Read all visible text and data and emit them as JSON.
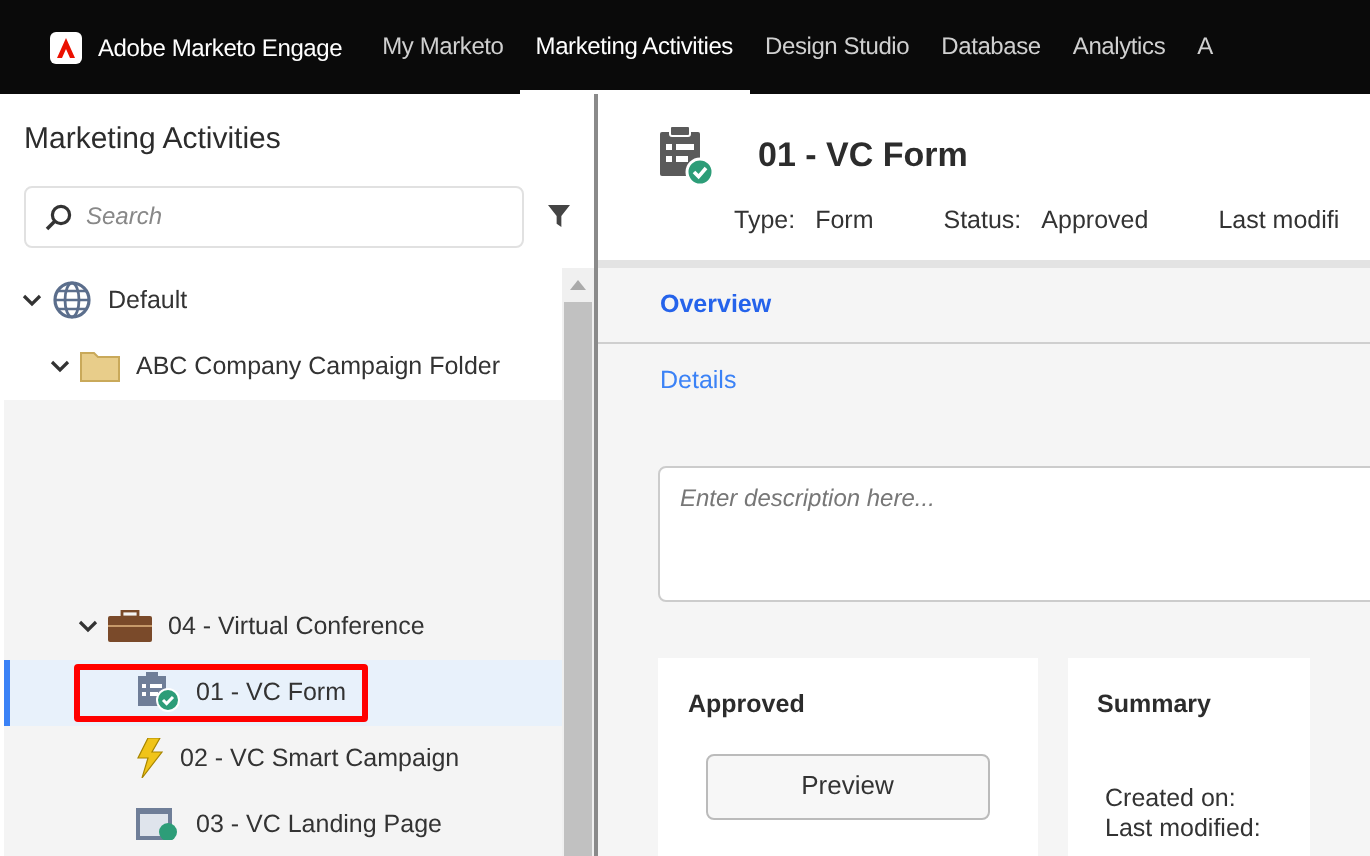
{
  "app": {
    "name": "Adobe Marketo Engage"
  },
  "nav_tabs": [
    {
      "label": "My Marketo",
      "selected": false
    },
    {
      "label": "Marketing Activities",
      "selected": true
    },
    {
      "label": "Design Studio",
      "selected": false
    },
    {
      "label": "Database",
      "selected": false
    },
    {
      "label": "Analytics",
      "selected": false
    },
    {
      "label": "A",
      "selected": false
    }
  ],
  "sidebar": {
    "title": "Marketing Activities",
    "search": {
      "placeholder": "Search"
    },
    "tree": [
      {
        "label": "Default",
        "kind": "workspace",
        "expanded": true,
        "selected": false,
        "children": [
          {
            "label": "ABC Company Campaign Folder",
            "kind": "folder",
            "expanded": true,
            "selected": false,
            "children": [
              {
                "label": "04 - Virtual Conference",
                "kind": "program",
                "expanded": true,
                "selected": false,
                "children": [
                  {
                    "label": "01 - VC Form",
                    "kind": "form",
                    "selected": true,
                    "highlighted": true
                  },
                  {
                    "label": "02 - VC Smart Campaign",
                    "kind": "campaign",
                    "selected": false,
                    "highlighted": false
                  },
                  {
                    "label": "03 - VC Landing Page",
                    "kind": "page",
                    "selected": false,
                    "highlighted": false
                  }
                ]
              }
            ]
          }
        ]
      }
    ]
  },
  "detail": {
    "title": "01 - VC Form",
    "meta": [
      {
        "label": "Type:",
        "value": "Form"
      },
      {
        "label": "Status:",
        "value": "Approved"
      },
      {
        "label": "Last modifi"
      }
    ],
    "sections": [
      {
        "label": "Overview",
        "selected": true
      },
      {
        "label": "Details",
        "selected": false
      }
    ],
    "description": {
      "placeholder": "Enter description here..."
    },
    "approved_card": {
      "title": "Approved",
      "button": "Preview"
    },
    "summary_card": {
      "title": "Summary",
      "fields": [
        "Created on:",
        "Last modified:"
      ]
    }
  }
}
